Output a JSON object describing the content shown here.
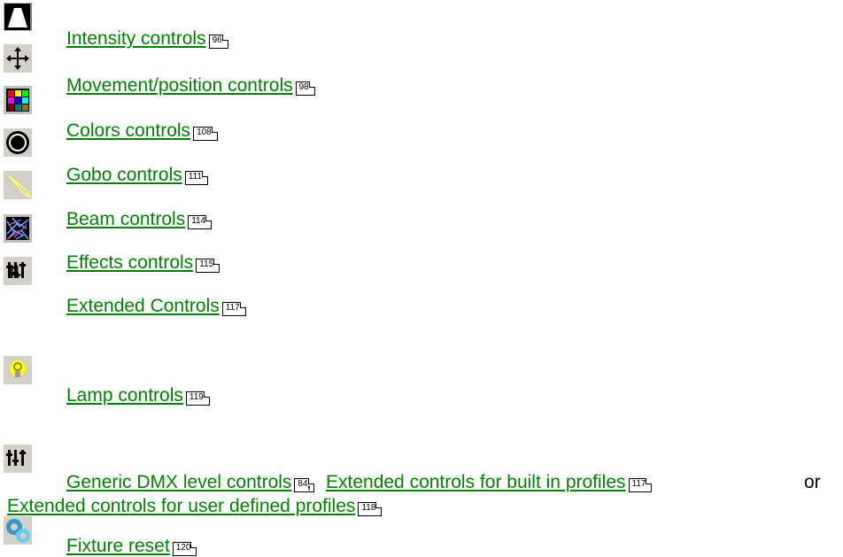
{
  "items": [
    {
      "label": "Intensity controls",
      "page": "96",
      "icon": "intensity-icon"
    },
    {
      "label": "Movement/position controls",
      "page": "98",
      "icon": "movement-icon"
    },
    {
      "label": "Colors controls",
      "page": "108",
      "icon": "colors-icon"
    },
    {
      "label": "Gobo controls",
      "page": "111",
      "icon": "gobo-icon"
    },
    {
      "label": "Beam controls",
      "page": "114",
      "icon": "beam-icon"
    },
    {
      "label": "Effects controls",
      "page": "115",
      "icon": "effects-icon"
    },
    {
      "label": "Extended Controls",
      "page": "117",
      "icon": "extended-controls-icon"
    },
    {
      "label": "Lamp controls",
      "page": "119",
      "icon": "lamp-icon"
    }
  ],
  "generic": {
    "icon": "dmx-sliders-icon",
    "link1": "Generic DMX level controls",
    "page1": "84",
    "sep": ",",
    "link2": "Extended controls for built in profiles",
    "page2": "117",
    "or": "or",
    "link3": "Extended controls for user defined profiles",
    "page3": "118"
  },
  "reset": {
    "label": "Fixture reset",
    "page": "120",
    "icon": "fixture-reset-icon"
  }
}
